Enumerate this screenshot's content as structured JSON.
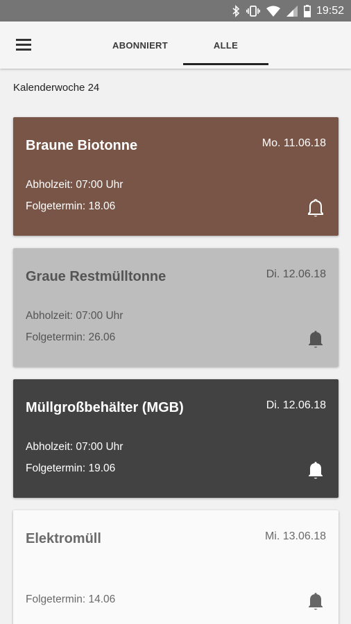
{
  "status_bar": {
    "time": "19:52",
    "icons": [
      "bluetooth-icon",
      "vibrate-icon",
      "wifi-icon",
      "signal-icon",
      "battery-icon"
    ]
  },
  "app_bar": {
    "menu_icon": "hamburger-menu-icon",
    "tabs": [
      {
        "label": "ABONNIERT",
        "selected": false
      },
      {
        "label": "ALLE",
        "selected": true
      }
    ]
  },
  "week_header": "Kalenderwoche 24",
  "cards": [
    {
      "title": "Braune Biotonne",
      "date": "Mo. 11.06.18",
      "pickup": "Abholzeit: 07:00 Uhr",
      "next": "Folgetermin: 18.06",
      "bell": "bell-outline-icon",
      "color": "#795548"
    },
    {
      "title": "Graue Restmülltonne",
      "date": "Di. 12.06.18",
      "pickup": "Abholzeit: 07:00 Uhr",
      "next": "Folgetermin: 26.06",
      "bell": "bell-filled-icon",
      "color": "#bdbdbd"
    },
    {
      "title": "Müllgroßbehälter (MGB)",
      "date": "Di. 12.06.18",
      "pickup": "Abholzeit: 07:00 Uhr",
      "next": "Folgetermin: 19.06",
      "bell": "bell-filled-icon",
      "color": "#424242"
    },
    {
      "title": "Elektromüll",
      "date": "Mi. 13.06.18",
      "next": "Folgetermin: 14.06",
      "bell": "bell-filled-icon",
      "color": "#fafafa"
    }
  ]
}
